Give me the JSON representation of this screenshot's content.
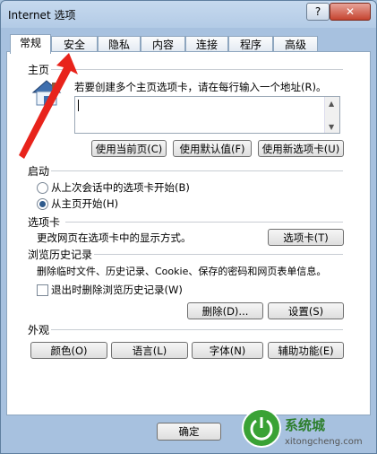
{
  "window": {
    "title": "Internet 选项",
    "help_label": "?",
    "close_label": "✕"
  },
  "tabs": [
    "常规",
    "安全",
    "隐私",
    "内容",
    "连接",
    "程序",
    "高级"
  ],
  "home": {
    "heading": "主页",
    "description": "若要创建多个主页选项卡，请在每行输入一个地址(R)。",
    "address_value": "",
    "buttons": [
      "使用当前页(C)",
      "使用默认值(F)",
      "使用新选项卡(U)"
    ]
  },
  "startup": {
    "heading": "启动",
    "options": [
      "从上次会话中的选项卡开始(B)",
      "从主页开始(H)"
    ],
    "selected": 1
  },
  "tabs_section": {
    "heading": "选项卡",
    "description": "更改网页在选项卡中的显示方式。",
    "button": "选项卡(T)"
  },
  "history": {
    "heading": "浏览历史记录",
    "description": "删除临时文件、历史记录、Cookie、保存的密码和网页表单信息。",
    "checkbox_label": "退出时删除浏览历史记录(W)",
    "checkbox_checked": false,
    "delete_button": "删除(D)...",
    "settings_button": "设置(S)"
  },
  "appearance": {
    "heading": "外观",
    "buttons": [
      "颜色(O)",
      "语言(L)",
      "字体(N)",
      "辅助功能(E)"
    ]
  },
  "footer": {
    "ok_button": "确定"
  },
  "watermark": {
    "brand": "系统城",
    "url": "xitongcheng.com"
  },
  "colors": {
    "arrow": "#e8231b",
    "tab_border": "#8ea6bf"
  }
}
